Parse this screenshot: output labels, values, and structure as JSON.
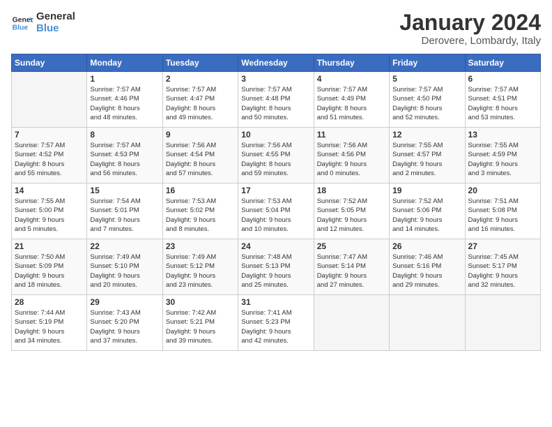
{
  "logo": {
    "line1": "General",
    "line2": "Blue"
  },
  "title": "January 2024",
  "subtitle": "Derovere, Lombardy, Italy",
  "weekdays": [
    "Sunday",
    "Monday",
    "Tuesday",
    "Wednesday",
    "Thursday",
    "Friday",
    "Saturday"
  ],
  "weeks": [
    [
      {
        "day": "",
        "sunrise": "",
        "sunset": "",
        "daylight": ""
      },
      {
        "day": "1",
        "sunrise": "Sunrise: 7:57 AM",
        "sunset": "Sunset: 4:46 PM",
        "daylight": "Daylight: 8 hours and 48 minutes."
      },
      {
        "day": "2",
        "sunrise": "Sunrise: 7:57 AM",
        "sunset": "Sunset: 4:47 PM",
        "daylight": "Daylight: 8 hours and 49 minutes."
      },
      {
        "day": "3",
        "sunrise": "Sunrise: 7:57 AM",
        "sunset": "Sunset: 4:48 PM",
        "daylight": "Daylight: 8 hours and 50 minutes."
      },
      {
        "day": "4",
        "sunrise": "Sunrise: 7:57 AM",
        "sunset": "Sunset: 4:49 PM",
        "daylight": "Daylight: 8 hours and 51 minutes."
      },
      {
        "day": "5",
        "sunrise": "Sunrise: 7:57 AM",
        "sunset": "Sunset: 4:50 PM",
        "daylight": "Daylight: 8 hours and 52 minutes."
      },
      {
        "day": "6",
        "sunrise": "Sunrise: 7:57 AM",
        "sunset": "Sunset: 4:51 PM",
        "daylight": "Daylight: 8 hours and 53 minutes."
      }
    ],
    [
      {
        "day": "7",
        "sunrise": "Sunrise: 7:57 AM",
        "sunset": "Sunset: 4:52 PM",
        "daylight": "Daylight: 8 hours and 55 minutes."
      },
      {
        "day": "8",
        "sunrise": "Sunrise: 7:57 AM",
        "sunset": "Sunset: 4:53 PM",
        "daylight": "Daylight: 8 hours and 56 minutes."
      },
      {
        "day": "9",
        "sunrise": "Sunrise: 7:56 AM",
        "sunset": "Sunset: 4:54 PM",
        "daylight": "Daylight: 8 hours and 57 minutes."
      },
      {
        "day": "10",
        "sunrise": "Sunrise: 7:56 AM",
        "sunset": "Sunset: 4:55 PM",
        "daylight": "Daylight: 8 hours and 59 minutes."
      },
      {
        "day": "11",
        "sunrise": "Sunrise: 7:56 AM",
        "sunset": "Sunset: 4:56 PM",
        "daylight": "Daylight: 9 hours and 0 minutes."
      },
      {
        "day": "12",
        "sunrise": "Sunrise: 7:55 AM",
        "sunset": "Sunset: 4:57 PM",
        "daylight": "Daylight: 9 hours and 2 minutes."
      },
      {
        "day": "13",
        "sunrise": "Sunrise: 7:55 AM",
        "sunset": "Sunset: 4:59 PM",
        "daylight": "Daylight: 9 hours and 3 minutes."
      }
    ],
    [
      {
        "day": "14",
        "sunrise": "Sunrise: 7:55 AM",
        "sunset": "Sunset: 5:00 PM",
        "daylight": "Daylight: 9 hours and 5 minutes."
      },
      {
        "day": "15",
        "sunrise": "Sunrise: 7:54 AM",
        "sunset": "Sunset: 5:01 PM",
        "daylight": "Daylight: 9 hours and 7 minutes."
      },
      {
        "day": "16",
        "sunrise": "Sunrise: 7:53 AM",
        "sunset": "Sunset: 5:02 PM",
        "daylight": "Daylight: 9 hours and 8 minutes."
      },
      {
        "day": "17",
        "sunrise": "Sunrise: 7:53 AM",
        "sunset": "Sunset: 5:04 PM",
        "daylight": "Daylight: 9 hours and 10 minutes."
      },
      {
        "day": "18",
        "sunrise": "Sunrise: 7:52 AM",
        "sunset": "Sunset: 5:05 PM",
        "daylight": "Daylight: 9 hours and 12 minutes."
      },
      {
        "day": "19",
        "sunrise": "Sunrise: 7:52 AM",
        "sunset": "Sunset: 5:06 PM",
        "daylight": "Daylight: 9 hours and 14 minutes."
      },
      {
        "day": "20",
        "sunrise": "Sunrise: 7:51 AM",
        "sunset": "Sunset: 5:08 PM",
        "daylight": "Daylight: 9 hours and 16 minutes."
      }
    ],
    [
      {
        "day": "21",
        "sunrise": "Sunrise: 7:50 AM",
        "sunset": "Sunset: 5:09 PM",
        "daylight": "Daylight: 9 hours and 18 minutes."
      },
      {
        "day": "22",
        "sunrise": "Sunrise: 7:49 AM",
        "sunset": "Sunset: 5:10 PM",
        "daylight": "Daylight: 9 hours and 20 minutes."
      },
      {
        "day": "23",
        "sunrise": "Sunrise: 7:49 AM",
        "sunset": "Sunset: 5:12 PM",
        "daylight": "Daylight: 9 hours and 23 minutes."
      },
      {
        "day": "24",
        "sunrise": "Sunrise: 7:48 AM",
        "sunset": "Sunset: 5:13 PM",
        "daylight": "Daylight: 9 hours and 25 minutes."
      },
      {
        "day": "25",
        "sunrise": "Sunrise: 7:47 AM",
        "sunset": "Sunset: 5:14 PM",
        "daylight": "Daylight: 9 hours and 27 minutes."
      },
      {
        "day": "26",
        "sunrise": "Sunrise: 7:46 AM",
        "sunset": "Sunset: 5:16 PM",
        "daylight": "Daylight: 9 hours and 29 minutes."
      },
      {
        "day": "27",
        "sunrise": "Sunrise: 7:45 AM",
        "sunset": "Sunset: 5:17 PM",
        "daylight": "Daylight: 9 hours and 32 minutes."
      }
    ],
    [
      {
        "day": "28",
        "sunrise": "Sunrise: 7:44 AM",
        "sunset": "Sunset: 5:19 PM",
        "daylight": "Daylight: 9 hours and 34 minutes."
      },
      {
        "day": "29",
        "sunrise": "Sunrise: 7:43 AM",
        "sunset": "Sunset: 5:20 PM",
        "daylight": "Daylight: 9 hours and 37 minutes."
      },
      {
        "day": "30",
        "sunrise": "Sunrise: 7:42 AM",
        "sunset": "Sunset: 5:21 PM",
        "daylight": "Daylight: 9 hours and 39 minutes."
      },
      {
        "day": "31",
        "sunrise": "Sunrise: 7:41 AM",
        "sunset": "Sunset: 5:23 PM",
        "daylight": "Daylight: 9 hours and 42 minutes."
      },
      {
        "day": "",
        "sunrise": "",
        "sunset": "",
        "daylight": ""
      },
      {
        "day": "",
        "sunrise": "",
        "sunset": "",
        "daylight": ""
      },
      {
        "day": "",
        "sunrise": "",
        "sunset": "",
        "daylight": ""
      }
    ]
  ]
}
